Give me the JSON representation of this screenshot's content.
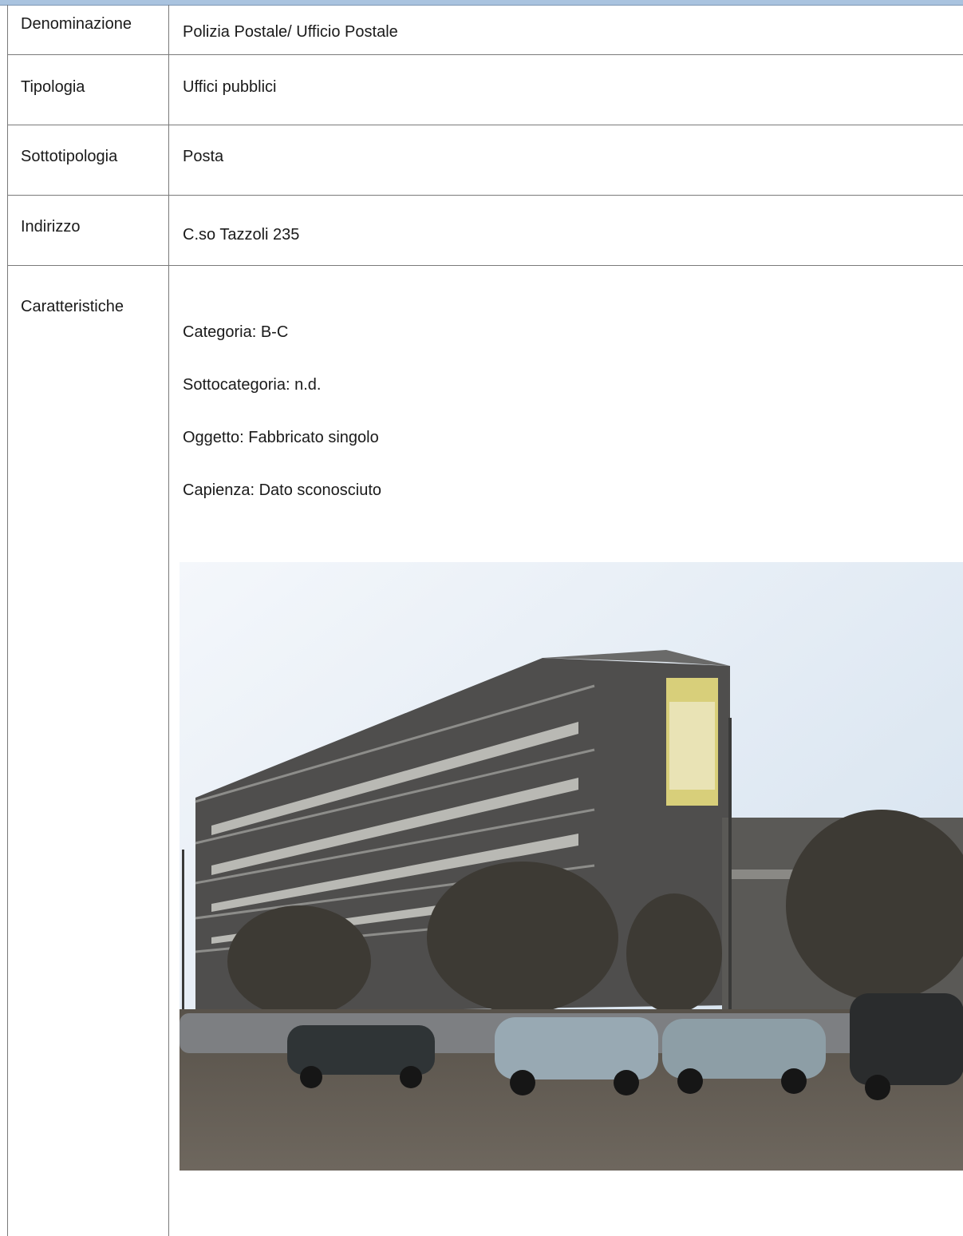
{
  "rows": [
    {
      "label": "Denominazione",
      "value": "Polizia Postale/ Ufficio Postale"
    },
    {
      "label": "Tipologia",
      "value": "Uffici pubblici"
    },
    {
      "label": "Sottotipologia",
      "value": "Posta"
    },
    {
      "label": "Indirizzo",
      "value": "C.so Tazzoli 235"
    },
    {
      "label": "Caratteristiche",
      "value": ""
    }
  ],
  "caratteristiche": {
    "categoria": "Categoria: B-C",
    "sottocategoria": "Sottocategoria: n.d.",
    "oggetto": "Oggetto: Fabbricato singolo",
    "capienza": "Capienza: Dato sconosciuto"
  },
  "colors": {
    "header_bar": "#a9c3df",
    "border": "#7a7a7a"
  }
}
